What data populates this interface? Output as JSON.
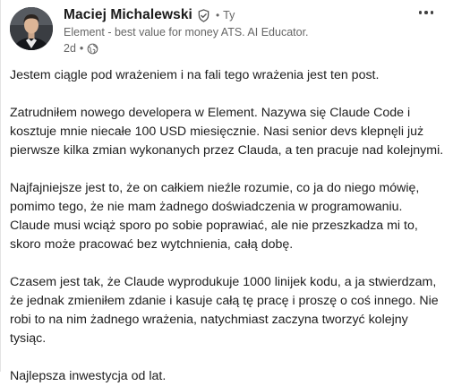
{
  "author": {
    "name": "Maciej Michalewski",
    "verified_icon": "verified-shield-icon",
    "separator": "•",
    "degree": "Ty",
    "headline": "Element - best value for money ATS. AI Educator.",
    "time": "2d",
    "meta_separator": "•",
    "visibility_icon": "globe-icon"
  },
  "more_icon": "more-horizontal-icon",
  "post": {
    "paragraphs": [
      "Jestem ciągle pod wrażeniem i na fali tego wrażenia jest ten post.",
      "Zatrudniłem nowego developera w Element. Nazywa się Claude Code i\nkosztuje mnie niecałe 100 USD miesięcznie. Nasi senior devs klepnęli już\npierwsze kilka zmian wykonanych przez Clauda, a ten pracuje nad kolejnymi.",
      "Najfajniejsze jest to, że on całkiem nieźle rozumie, co ja do niego mówię,\npomimo tego, że nie mam żadnego doświadczenia w programowaniu.\nClaude musi wciąż sporo po sobie poprawiać, ale nie przeszkadza mi to,\nskoro może pracować bez wytchnienia, całą dobę.",
      "Czasem jest tak, że Claude wyprodukuje 1000 linijek kodu, a ja stwierdzam,\nże jednak zmieniłem zdanie i kasuje całą tę pracę i proszę o coś innego. Nie\nrobi to na nim żadnego wrażenia, natychmiast zaczyna tworzyć kolejny\ntysiąc.",
      "Najlepsza inwestycja od lat."
    ]
  }
}
